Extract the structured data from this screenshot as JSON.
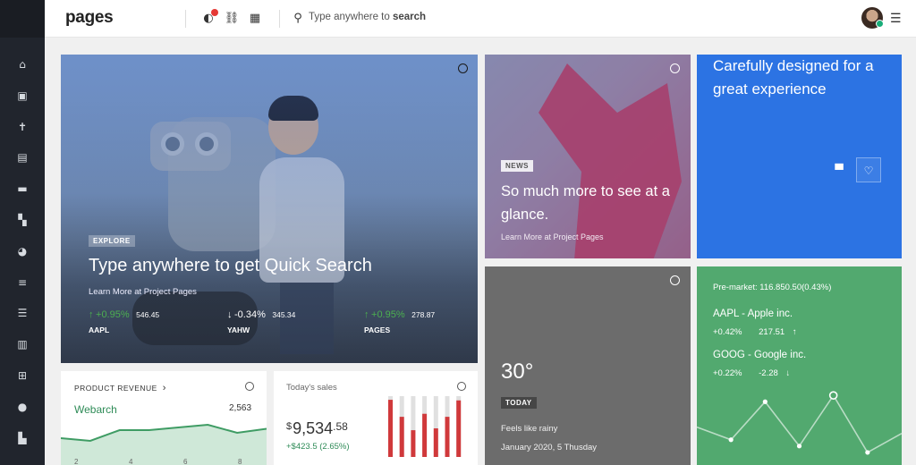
{
  "app": {
    "logo": "pages"
  },
  "header": {
    "search_prefix": "Type anywhere to",
    "search_bold": "search"
  },
  "sidebar": {
    "icons": [
      "home-icon",
      "inbox-icon",
      "accessibility-icon",
      "calendar-icon",
      "paint-roller-icon",
      "dashboard-icon",
      "chat-icon",
      "list-icon",
      "database-icon",
      "columns-icon",
      "grid-icon",
      "map-pin-icon",
      "chart-icon"
    ]
  },
  "hero": {
    "tag": "EXPLORE",
    "title": "Type anywhere to get Quick Search",
    "subtitle": "Learn More at Project Pages",
    "stocks": [
      {
        "arrow": "↑",
        "pct": "+0.95%",
        "value": "546.45",
        "symbol": "AAPL"
      },
      {
        "arrow": "↓",
        "pct": "-0.34%",
        "value": "345.34",
        "symbol": "YAHW"
      },
      {
        "arrow": "↑",
        "pct": "+0.95%",
        "value": "278.87",
        "symbol": "PAGES"
      }
    ]
  },
  "news": {
    "tag": "NEWS",
    "title": "So much more to see at a glance.",
    "subtitle": "Learn More at Project Pages"
  },
  "promo": {
    "title": "Carefully designed for a great experience"
  },
  "weather": {
    "temp": "30°",
    "tag": "TODAY",
    "desc": "Feels like rainy",
    "date": "January 2020, 5 Thusday"
  },
  "market": {
    "premarket": "Pre-market: 116.850.50(0.43%)",
    "quotes": [
      {
        "name": "AAPL - Apple inc.",
        "pct": "+0.42%",
        "value": "217.51",
        "arrow": "↑"
      },
      {
        "name": "GOOG - Google inc.",
        "pct": "+0.22%",
        "value": "-2.28",
        "arrow": "↓"
      }
    ]
  },
  "revenue": {
    "title": "PRODUCT REVENUE",
    "chevron": "›",
    "series_name": "Webarch",
    "value": "2,563",
    "axis_ticks": [
      "2",
      "4",
      "6",
      "8"
    ]
  },
  "sales": {
    "title": "Today's sales",
    "currency": "$",
    "amount": "9,534",
    "cents": ".58",
    "change": "+$423.5 (2.65%)"
  },
  "colors": {
    "accent_blue": "#2c73e3",
    "accent_green": "#52a96f",
    "bar_red": "#d0393b",
    "sidebar": "#21252d"
  },
  "chart_data": [
    {
      "type": "area",
      "title": "PRODUCT REVENUE",
      "series": [
        {
          "name": "Webarch",
          "values": [
            10,
            9,
            13,
            13,
            14,
            15,
            12,
            13.5
          ]
        }
      ],
      "x": [
        1,
        2,
        3,
        4,
        5,
        6,
        7,
        8
      ],
      "ylim": [
        0,
        20
      ]
    },
    {
      "type": "bar",
      "title": "Today's sales",
      "categories": [
        "1",
        "2",
        "3",
        "4",
        "5",
        "6",
        "7"
      ],
      "values": [
        0.94,
        0.66,
        0.44,
        0.71,
        0.47,
        0.66,
        0.93
      ],
      "ylim": [
        0,
        1
      ]
    },
    {
      "type": "line",
      "series": [
        {
          "values": [
            5,
            3,
            9,
            2,
            10,
            1,
            4
          ]
        }
      ],
      "ylim": [
        0,
        12
      ]
    }
  ]
}
